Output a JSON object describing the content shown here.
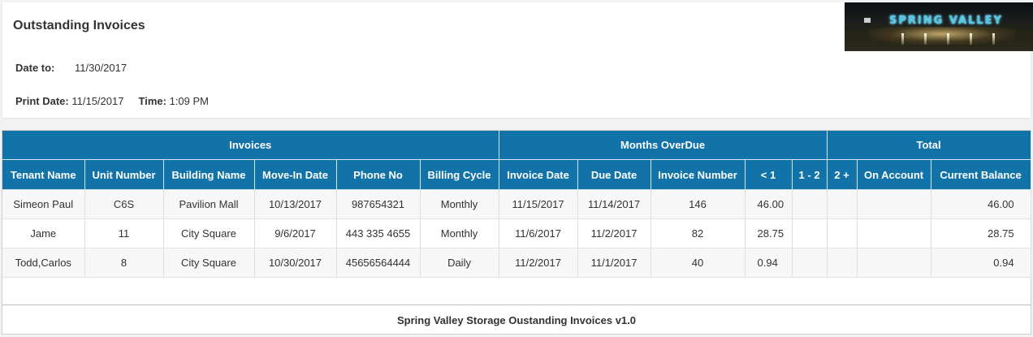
{
  "report": {
    "title": "Outstanding Invoices",
    "date_to_label": "Date to:",
    "date_to_value": "11/30/2017",
    "print_date_label": "Print Date:",
    "print_date_value": "11/15/2017",
    "time_label": "Time:",
    "time_value": "1:09 PM",
    "logo_text": "SPRING VALLEY"
  },
  "table": {
    "groups": [
      "Invoices",
      "Months OverDue",
      "Total"
    ],
    "columns": [
      "Tenant Name",
      "Unit Number",
      "Building Name",
      "Move-In Date",
      "Phone No",
      "Billing Cycle",
      "Invoice Date",
      "Due Date",
      "Invoice Number",
      "< 1",
      "1 - 2",
      "2 +",
      "On Account",
      "Current Balance"
    ],
    "rows": [
      [
        "Simeon Paul",
        "C6S",
        "Pavilion Mall",
        "10/13/2017",
        "987654321",
        "Monthly",
        "11/15/2017",
        "11/14/2017",
        "146",
        "46.00",
        "",
        "",
        "",
        "46.00"
      ],
      [
        "Jame",
        "11",
        "City Square",
        "9/6/2017",
        "443 335 4655",
        "Monthly",
        "11/6/2017",
        "11/2/2017",
        "82",
        "28.75",
        "",
        "",
        "",
        "28.75"
      ],
      [
        "Todd,Carlos",
        "8",
        "City Square",
        "10/30/2017",
        "45656564444",
        "Daily",
        "11/2/2017",
        "11/1/2017",
        "40",
        "0.94",
        "",
        "",
        "",
        "0.94"
      ]
    ]
  },
  "footer": {
    "text": "Spring Valley Storage Oustanding Invoices v1.0"
  },
  "colors": {
    "header_bg": "#1273a8",
    "row_alt": "#f7f7f7"
  }
}
